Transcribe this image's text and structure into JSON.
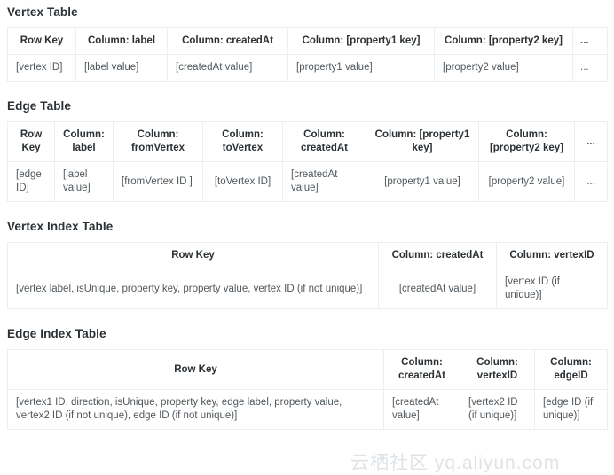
{
  "watermark": "云栖社区 yq.aliyun.com",
  "sections": [
    {
      "title": "Vertex Table",
      "name": "vertex-table",
      "headers": [
        "Row Key",
        "Column: label",
        "Column: createdAt",
        "Column: [property1 key]",
        "Column: [property2 key]",
        "..."
      ],
      "rows": [
        [
          "[vertex ID]",
          "[label value]",
          "[createdAt value]",
          "[property1 value]",
          "[property2 value]",
          "..."
        ]
      ]
    },
    {
      "title": "Edge Table",
      "name": "edge-table",
      "headers": [
        "Row Key",
        "Column: label",
        "Column: fromVertex",
        "Column: toVertex",
        "Column: createdAt",
        "Column: [property1 key]",
        "Column: [property2 key]",
        "..."
      ],
      "rows": [
        [
          "[edge ID]",
          "[label value]",
          "[fromVertex ID ]",
          "[toVertex ID]",
          "[createdAt value]",
          "[property1 value]",
          "[property2 value]",
          "..."
        ]
      ]
    },
    {
      "title": "Vertex Index Table",
      "name": "vertex-index-table",
      "headers": [
        "Row Key",
        "Column: createdAt",
        "Column: vertexID"
      ],
      "rows": [
        [
          "[vertex label, isUnique, property key, property value, vertex ID (if not unique)]",
          "[createdAt value]",
          "[vertex ID (if unique)]"
        ]
      ]
    },
    {
      "title": "Edge Index Table",
      "name": "edge-index-table",
      "headers": [
        "Row Key",
        "Column: createdAt",
        "Column: vertexID",
        "Column: edgeID"
      ],
      "rows": [
        [
          "[vertex1 ID, direction, isUnique, property key, edge label, property value, vertex2 ID (if not unique), edge ID (if not unique)]",
          "[createdAt value]",
          "[vertex2 ID (if unique)]",
          "[edge ID (if unique)]"
        ]
      ]
    }
  ]
}
